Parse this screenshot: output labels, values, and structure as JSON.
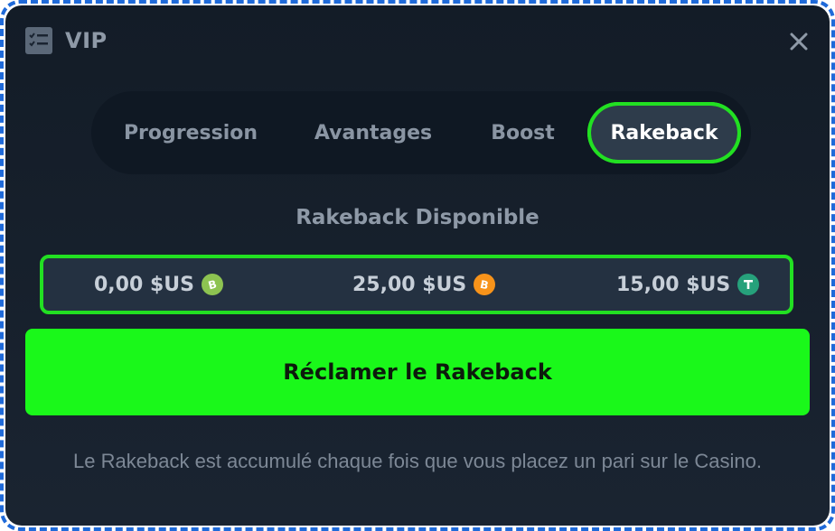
{
  "header": {
    "title": "VIP",
    "icon": "checklist-icon",
    "close_icon": "close-icon"
  },
  "tabs": [
    {
      "label": "Progression",
      "active": false
    },
    {
      "label": "Avantages",
      "active": false
    },
    {
      "label": "Boost",
      "active": false
    },
    {
      "label": "Rakeback",
      "active": true
    }
  ],
  "rakeback": {
    "title": "Rakeback Disponible",
    "balances": [
      {
        "amount": "0,00 $US",
        "coin": "bitcoin-cash-icon",
        "color": "#8dc351"
      },
      {
        "amount": "25,00 $US",
        "coin": "bitcoin-icon",
        "color": "#f7931a"
      },
      {
        "amount": "15,00 $US",
        "coin": "tether-icon",
        "color": "#26a17b"
      }
    ],
    "claim_label": "Réclamer le Rakeback",
    "info_text": "Le Rakeback est accumulé chaque fois que vous placez un pari sur le Casino."
  },
  "colors": {
    "accent_green": "#1af81a",
    "highlight_outline": "#22e022",
    "frame_border": "#1f6ad9"
  }
}
